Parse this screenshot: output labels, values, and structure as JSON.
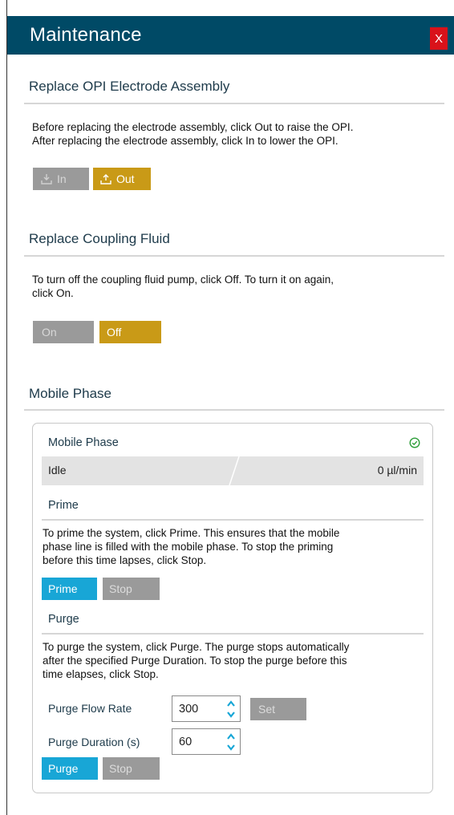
{
  "header": {
    "title": "Maintenance",
    "close_label": "X"
  },
  "opi": {
    "title": "Replace OPI Electrode Assembly",
    "desc_line1": "Before replacing the electrode assembly, click Out to raise the OPI.",
    "desc_line2": "After replacing the electrode assembly, click In to lower the OPI.",
    "in_label": "In",
    "out_label": "Out"
  },
  "coupling": {
    "title": "Replace Coupling Fluid",
    "desc_line1": "To turn off the coupling fluid pump, click Off. To turn it on again,",
    "desc_line2": "click On.",
    "on_label": "On",
    "off_label": "Off"
  },
  "mobile_phase": {
    "title": "Mobile Phase",
    "panel_title": "Mobile Phase",
    "status": "Idle",
    "flow_value": "0  µl/min",
    "prime": {
      "title": "Prime",
      "desc_line1": "To prime the system, click Prime. This ensures that the mobile",
      "desc_line2": "phase line is filled with the mobile phase. To stop the priming",
      "desc_line3": "before this time lapses, click Stop.",
      "prime_label": "Prime",
      "stop_label": "Stop"
    },
    "purge": {
      "title": "Purge",
      "desc_line1": "To purge the system, click Purge. The purge stops automatically",
      "desc_line2": "after the specified Purge Duration. To stop the purge before this",
      "desc_line3": "time elapses, click Stop.",
      "flow_rate_label": "Purge Flow Rate",
      "flow_rate_value": "300",
      "set_label": "Set",
      "duration_label": "Purge Duration (s)",
      "duration_value": "60",
      "purge_label": "Purge",
      "stop_label": "Stop"
    }
  },
  "colors": {
    "header": "#004a66",
    "close": "#d9121a",
    "gold": "#c99a17",
    "blue": "#18a6d6",
    "disabled": "#9a9a9a",
    "status_ok": "#2e9e3a"
  }
}
